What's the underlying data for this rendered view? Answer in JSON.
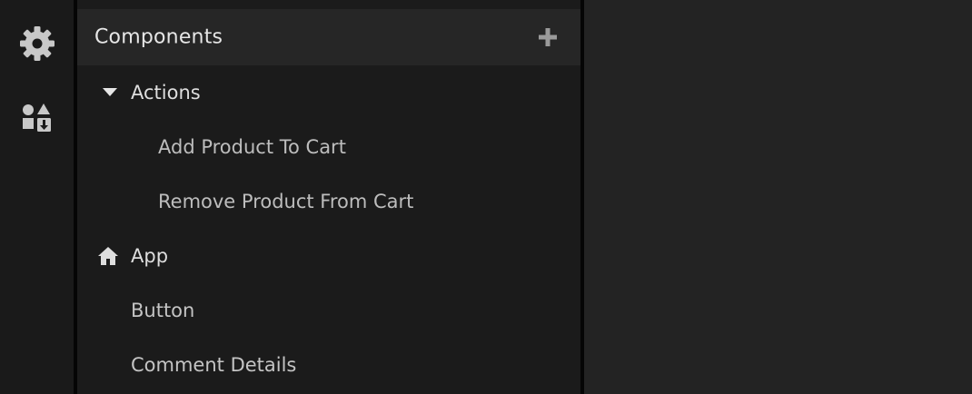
{
  "panel": {
    "title": "Components",
    "add_label": "+"
  },
  "tree": {
    "group_actions": "Actions",
    "action_items": [
      "Add Product To Cart",
      "Remove Product From Cart"
    ],
    "app_label": "App",
    "items": [
      "Button",
      "Comment Details"
    ]
  },
  "icons": {
    "settings": "gear-icon",
    "components": "shapes-download-icon",
    "add": "plus-icon",
    "expand": "caret-down-icon",
    "app": "home-icon"
  },
  "colors": {
    "rail_bg": "#1a1a1a",
    "panel_bg": "#1b1b1b",
    "header_bg": "#262626",
    "separator": "#050505",
    "main_bg": "#232323",
    "icon": "#c8c8c8",
    "text_primary": "#e6e6e6",
    "text_secondary": "#bdbdbd"
  }
}
